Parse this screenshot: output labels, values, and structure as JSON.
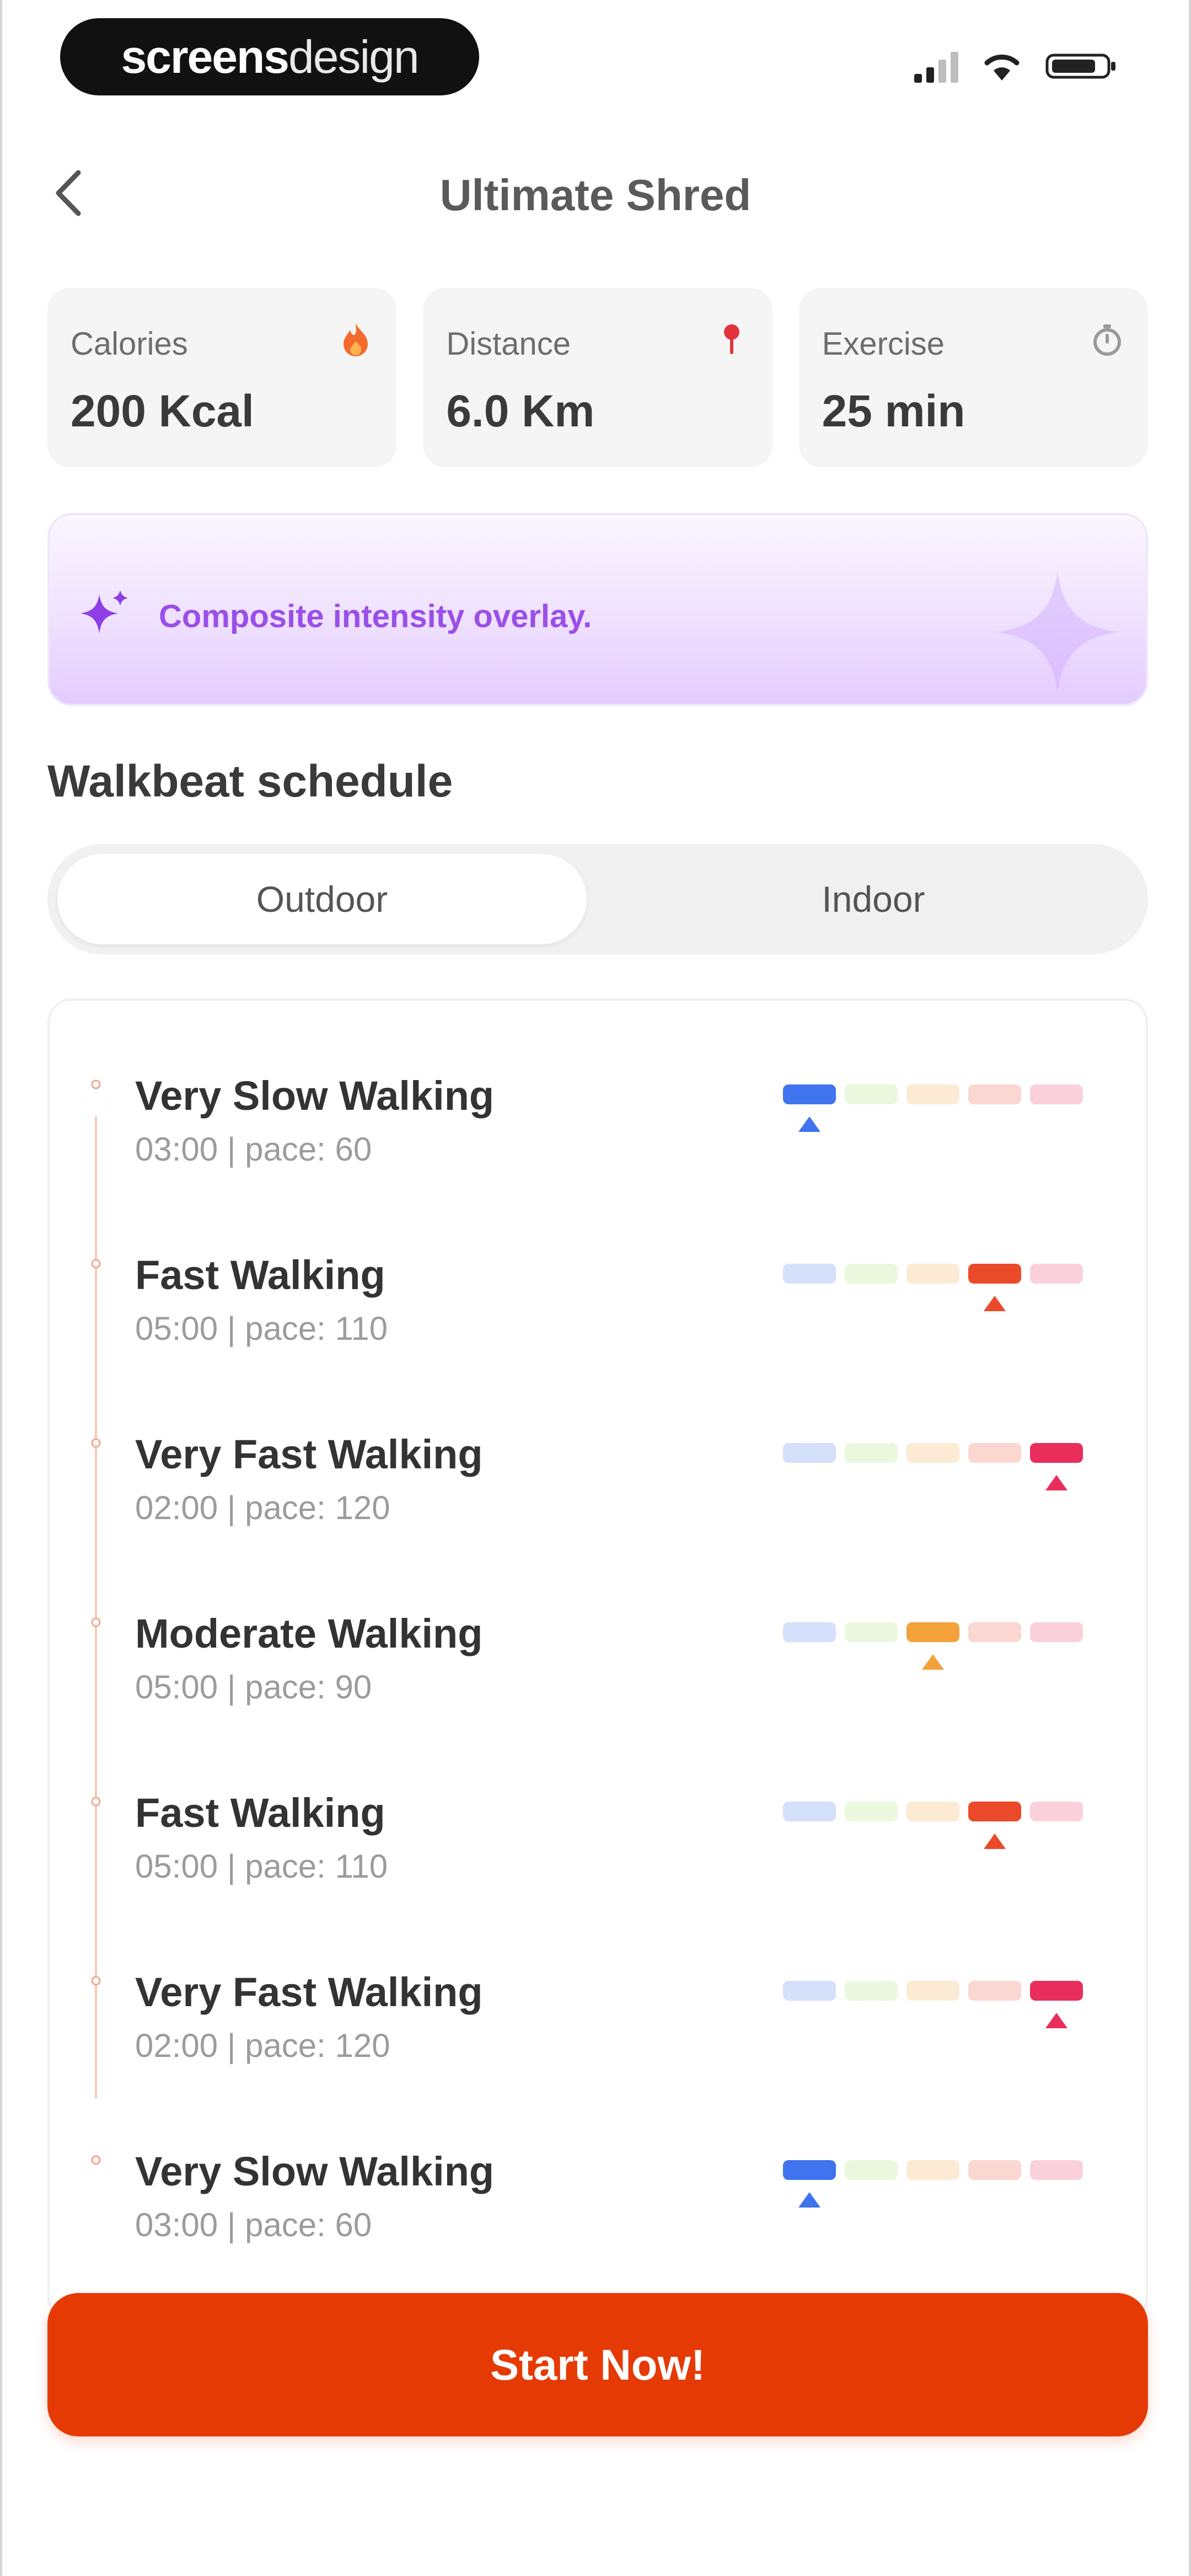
{
  "status_bar": {
    "logo_bold": "screens",
    "logo_light": "design"
  },
  "header": {
    "title": "Ultimate Shred"
  },
  "stats": [
    {
      "label": "Calories",
      "value": "200 Kcal",
      "icon": "flame-icon",
      "icon_color": "#f26a2e"
    },
    {
      "label": "Distance",
      "value": "6.0 Km",
      "icon": "location-pin-icon",
      "icon_color": "#e2333b"
    },
    {
      "label": "Exercise",
      "value": "25 min",
      "icon": "timer-icon",
      "icon_color": "#9a9a9a"
    }
  ],
  "banner": {
    "text": "Composite intensity overlay.",
    "accent": "#9a4fe8"
  },
  "schedule": {
    "title": "Walkbeat schedule",
    "tabs": [
      {
        "label": "Outdoor",
        "selected": true
      },
      {
        "label": "Indoor",
        "selected": false
      }
    ],
    "intensity_colors": [
      "#3f74ee",
      "#a8e06b",
      "#f3a13a",
      "#ea4a2a",
      "#ea2e5b"
    ],
    "items": [
      {
        "name": "Very Slow Walking",
        "meta": "03:00 | pace: 60",
        "level": 1
      },
      {
        "name": "Fast Walking",
        "meta": "05:00 | pace: 110",
        "level": 4
      },
      {
        "name": "Very Fast Walking",
        "meta": "02:00 | pace: 120",
        "level": 5
      },
      {
        "name": "Moderate Walking",
        "meta": "05:00 | pace: 90",
        "level": 3
      },
      {
        "name": "Fast Walking",
        "meta": "05:00 | pace: 110",
        "level": 4
      },
      {
        "name": "Very Fast Walking",
        "meta": "02:00 | pace: 120",
        "level": 5
      },
      {
        "name": "Very Slow Walking",
        "meta": "03:00 | pace: 60",
        "level": 1
      }
    ]
  },
  "actions": {
    "start_label": "Start Now!",
    "start_color": "#e63a05"
  }
}
